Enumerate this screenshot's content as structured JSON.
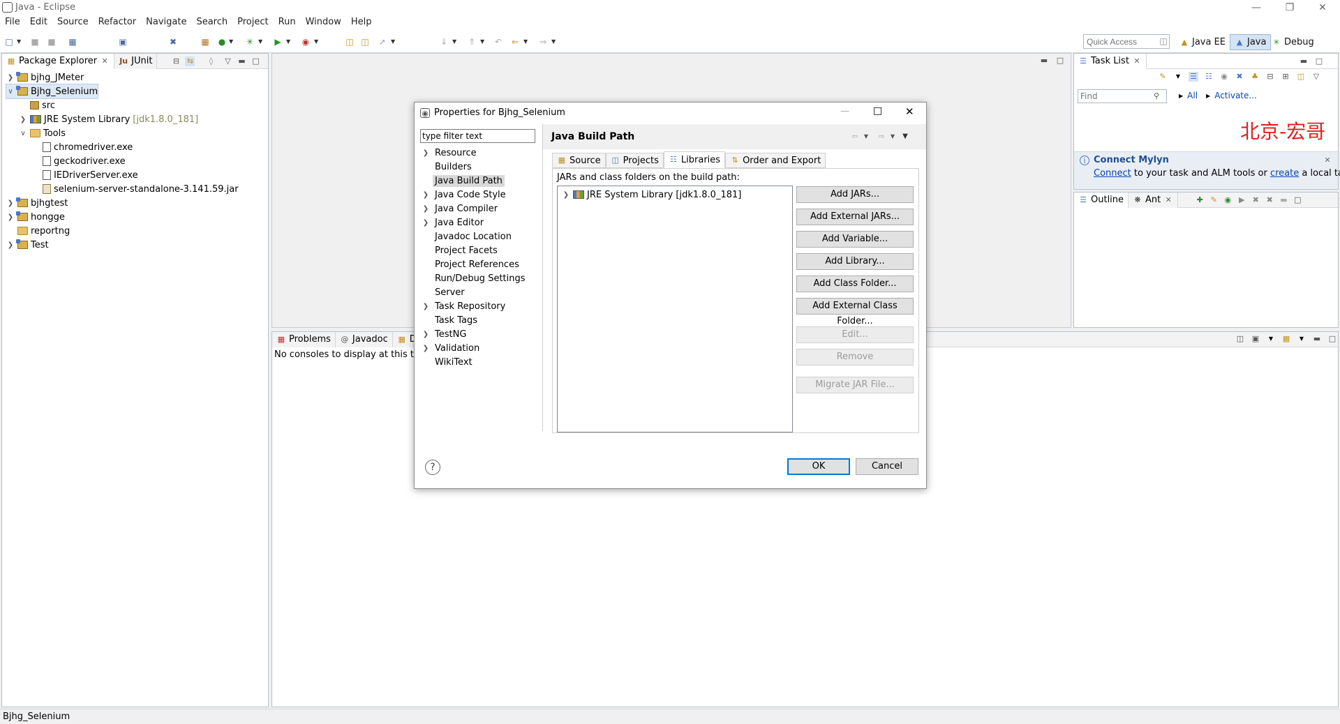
{
  "window": {
    "title": "Java - Eclipse"
  },
  "menu": [
    "File",
    "Edit",
    "Source",
    "Refactor",
    "Navigate",
    "Search",
    "Project",
    "Run",
    "Window",
    "Help"
  ],
  "toolbar": {
    "quick_access_placeholder": "Quick Access"
  },
  "perspectives": [
    {
      "label": "Java EE",
      "icon": "java-ee-icon"
    },
    {
      "label": "Java",
      "icon": "java-perspective-icon"
    },
    {
      "label": "Debug",
      "icon": "debug-icon"
    }
  ],
  "package_explorer": {
    "tabs": [
      "Package Explorer",
      "JUnit"
    ],
    "tree": [
      {
        "label": "bjhg_JMeter",
        "type": "project",
        "expander": "collapsed",
        "indent": 0
      },
      {
        "label": "Bjhg_Selenium",
        "type": "project",
        "expander": "expanded",
        "indent": 0,
        "selected": true
      },
      {
        "label": "src",
        "type": "package",
        "expander": "none",
        "indent": 1
      },
      {
        "label": "JRE System Library",
        "suffix": "[jdk1.8.0_181]",
        "type": "library",
        "expander": "collapsed",
        "indent": 1
      },
      {
        "label": "Tools",
        "type": "folder",
        "expander": "expanded",
        "indent": 1
      },
      {
        "label": "chromedriver.exe",
        "type": "file",
        "expander": "none",
        "indent": 2
      },
      {
        "label": "geckodriver.exe",
        "type": "file",
        "expander": "none",
        "indent": 2
      },
      {
        "label": "IEDriverServer.exe",
        "type": "file",
        "expander": "none",
        "indent": 2
      },
      {
        "label": "selenium-server-standalone-3.141.59.jar",
        "type": "jar",
        "expander": "none",
        "indent": 2
      },
      {
        "label": "bjhgtest",
        "type": "project",
        "expander": "collapsed",
        "indent": 0
      },
      {
        "label": "hongge",
        "type": "project",
        "expander": "collapsed",
        "indent": 0
      },
      {
        "label": "reportng",
        "type": "folder",
        "expander": "none",
        "indent": 0
      },
      {
        "label": "Test",
        "type": "project",
        "expander": "collapsed",
        "indent": 0
      }
    ]
  },
  "task_list": {
    "tab": "Task List",
    "find_placeholder": "Find",
    "all_label": "All",
    "activate_label": "Activate...",
    "watermark": "北京-宏哥",
    "mylyn_title": "Connect Mylyn",
    "mylyn_connect": "Connect",
    "mylyn_mid": " to your task and ALM tools or ",
    "mylyn_create": "create",
    "mylyn_end": " a local task."
  },
  "outline": {
    "tabs": [
      "Outline",
      "Ant"
    ]
  },
  "console": {
    "tabs": [
      "Problems",
      "Javadoc",
      "Dec"
    ],
    "message": "No consoles to display at this time."
  },
  "dialog": {
    "title": "Properties for Bjhg_Selenium",
    "filter_placeholder": "type filter text",
    "nav": [
      {
        "label": "Resource",
        "expander": true
      },
      {
        "label": "Builders",
        "expander": false
      },
      {
        "label": "Java Build Path",
        "expander": false,
        "selected": true
      },
      {
        "label": "Java Code Style",
        "expander": true
      },
      {
        "label": "Java Compiler",
        "expander": true
      },
      {
        "label": "Java Editor",
        "expander": true
      },
      {
        "label": "Javadoc Location",
        "expander": false
      },
      {
        "label": "Project Facets",
        "expander": false
      },
      {
        "label": "Project References",
        "expander": false
      },
      {
        "label": "Run/Debug Settings",
        "expander": false
      },
      {
        "label": "Server",
        "expander": false
      },
      {
        "label": "Task Repository",
        "expander": true
      },
      {
        "label": "Task Tags",
        "expander": false
      },
      {
        "label": "TestNG",
        "expander": true
      },
      {
        "label": "Validation",
        "expander": true
      },
      {
        "label": "WikiText",
        "expander": false
      }
    ],
    "page_title": "Java Build Path",
    "tabs": [
      {
        "label": "Source",
        "active": false
      },
      {
        "label": "Projects",
        "active": false
      },
      {
        "label": "Libraries",
        "active": true
      },
      {
        "label": "Order and Export",
        "active": false
      }
    ],
    "jars_label": "JARs and class folders on the build path:",
    "library_entry": "JRE System Library [jdk1.8.0_181]",
    "buttons": [
      {
        "label": "Add JARs...",
        "enabled": true
      },
      {
        "label": "Add External JARs...",
        "enabled": true
      },
      {
        "label": "Add Variable...",
        "enabled": true
      },
      {
        "label": "Add Library...",
        "enabled": true
      },
      {
        "label": "Add Class Folder...",
        "enabled": true
      },
      {
        "label": "Add External Class Folder...",
        "enabled": true
      },
      {
        "label": "Edit...",
        "enabled": false
      },
      {
        "label": "Remove",
        "enabled": false
      },
      {
        "label": "Migrate JAR File...",
        "enabled": false
      }
    ],
    "ok": "OK",
    "cancel": "Cancel"
  },
  "status": {
    "text": "Bjhg_Selenium"
  }
}
